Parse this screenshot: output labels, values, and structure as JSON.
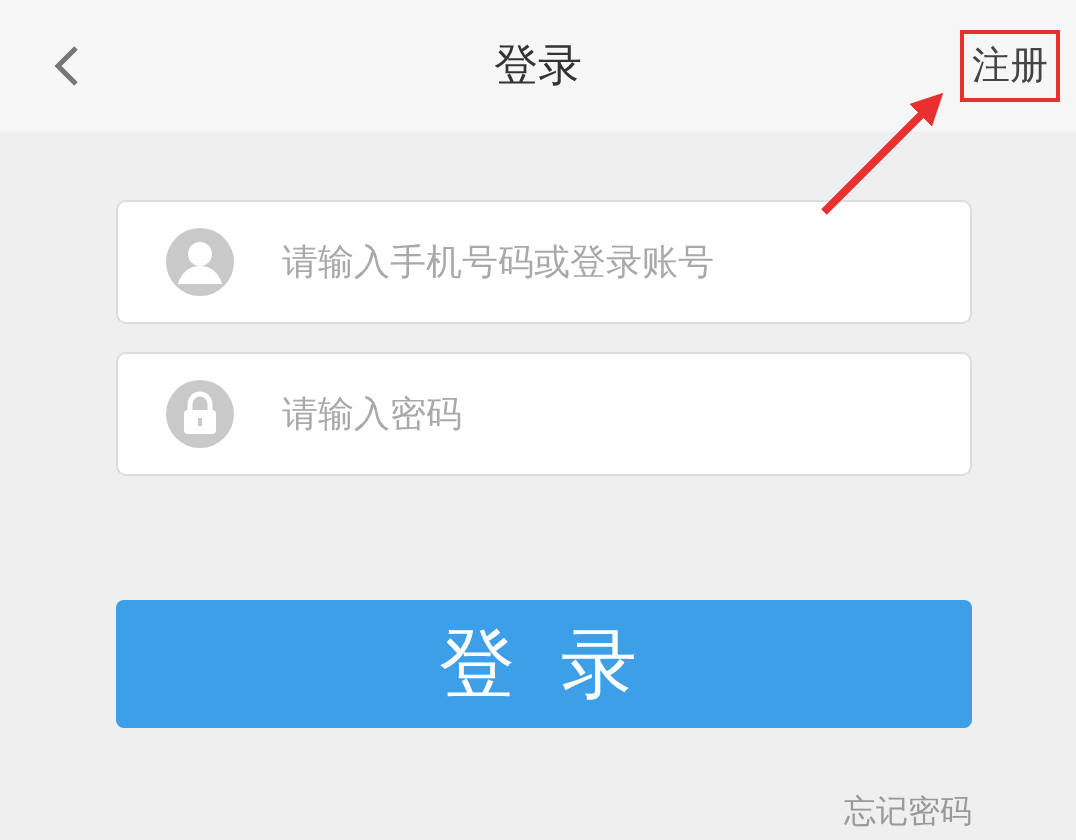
{
  "header": {
    "title": "登录",
    "register": "注册",
    "register_highlighted": true
  },
  "fields": [
    {
      "kind": "user",
      "placeholder": "请输入手机号码或登录账号"
    },
    {
      "kind": "password",
      "placeholder": "请输入密码"
    }
  ],
  "login_button": "登录",
  "forgot_password": "忘记密码"
}
